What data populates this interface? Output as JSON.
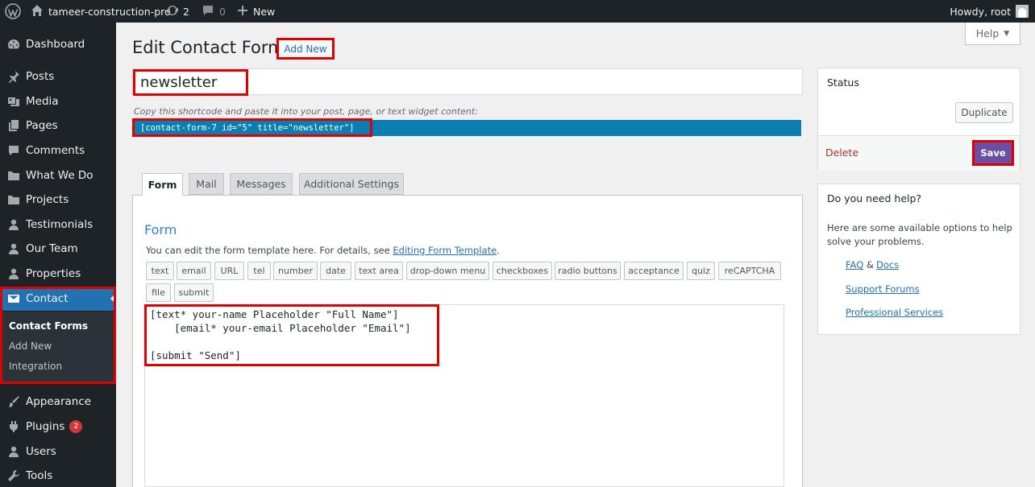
{
  "adminbar": {
    "site_name": "tameer-construction-pro",
    "updates_count": "2",
    "comments_count": "0",
    "new_label": "New",
    "howdy": "Howdy, root"
  },
  "sidebar": {
    "items": [
      {
        "label": "Dashboard",
        "icon": "dashboard-icon"
      },
      {
        "label": "Posts",
        "icon": "pin-icon"
      },
      {
        "label": "Media",
        "icon": "media-icon"
      },
      {
        "label": "Pages",
        "icon": "pages-icon"
      },
      {
        "label": "Comments",
        "icon": "comment-icon"
      },
      {
        "label": "What We Do",
        "icon": "folder-icon"
      },
      {
        "label": "Projects",
        "icon": "folder-icon"
      },
      {
        "label": "Testimonials",
        "icon": "user-icon"
      },
      {
        "label": "Our Team",
        "icon": "user-icon"
      },
      {
        "label": "Properties",
        "icon": "user-icon"
      },
      {
        "label": "Contact",
        "icon": "mail-icon"
      },
      {
        "label": "Appearance",
        "icon": "brush-icon"
      },
      {
        "label": "Plugins",
        "icon": "plugin-icon",
        "badge": "2"
      },
      {
        "label": "Users",
        "icon": "user-icon"
      },
      {
        "label": "Tools",
        "icon": "wrench-icon"
      }
    ],
    "submenu": [
      "Contact Forms",
      "Add New",
      "Integration"
    ]
  },
  "help_tab": "Help",
  "page": {
    "title": "Edit Contact Form",
    "add_new": "Add New",
    "form_title_value": "newsletter",
    "shortcode_desc": "Copy this shortcode and paste it into your post, page, or text widget content:",
    "shortcode": "[contact-form-7 id=\"5\" title=\"newsletter\"]"
  },
  "tabs": [
    "Form",
    "Mail",
    "Messages",
    "Additional Settings"
  ],
  "form_panel": {
    "heading": "Form",
    "desc_prefix": "You can edit the form template here. For details, see ",
    "desc_link": "Editing Form Template",
    "desc_suffix": ".",
    "tag_buttons": [
      "text",
      "email",
      "URL",
      "tel",
      "number",
      "date",
      "text area",
      "drop-down menu",
      "checkboxes",
      "radio buttons",
      "acceptance",
      "quiz",
      "reCAPTCHA",
      "file",
      "submit"
    ],
    "code_lines": [
      "[text* your-name Placeholder \"Full Name\"]",
      "    [email* your-email Placeholder \"Email\"]",
      "",
      "[submit \"Send\"]"
    ]
  },
  "status_box": {
    "title": "Status",
    "duplicate": "Duplicate",
    "delete": "Delete",
    "save": "Save"
  },
  "help_box": {
    "title": "Do you need help?",
    "text": "Here are some available options to help solve your problems.",
    "faq": "FAQ",
    "amp": "&",
    "docs": "Docs",
    "support": "Support Forums",
    "services": "Professional Services"
  }
}
